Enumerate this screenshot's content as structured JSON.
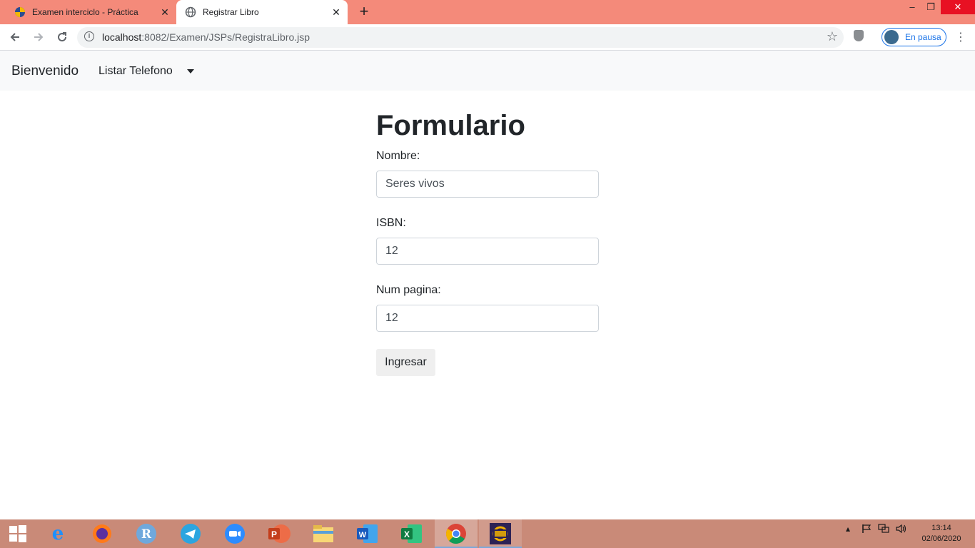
{
  "browser": {
    "tabs": [
      {
        "title": "Examen interciclo - Práctica",
        "active": false
      },
      {
        "title": "Registrar Libro",
        "active": true
      }
    ],
    "url_host": "localhost",
    "url_rest": ":8082/Examen/JSPs/RegistraLibro.jsp",
    "profile_label": "En pausa",
    "new_tab": "+",
    "min": "–",
    "max": "❐",
    "close": "✕"
  },
  "navbar": {
    "brand": "Bienvenido",
    "link": "Listar Telefono"
  },
  "form": {
    "title": "Formulario",
    "fields": [
      {
        "label": "Nombre:",
        "value": "Seres vivos"
      },
      {
        "label": "ISBN:",
        "value": "12"
      },
      {
        "label": "Num pagina:",
        "value": "12"
      }
    ],
    "submit_label": "Ingresar"
  },
  "taskbar": {
    "apps": [
      "windows-start",
      "internet-explorer",
      "firefox",
      "r",
      "telegram",
      "zoom",
      "powerpoint",
      "file-explorer",
      "word",
      "excel",
      "chrome",
      "java-ee-ide"
    ],
    "time": "13:14",
    "date": "02/06/2020"
  },
  "colors": {
    "tabstrip": "#f48a7a",
    "navbar": "#f8f9fa",
    "taskbar": "#c98a78"
  }
}
